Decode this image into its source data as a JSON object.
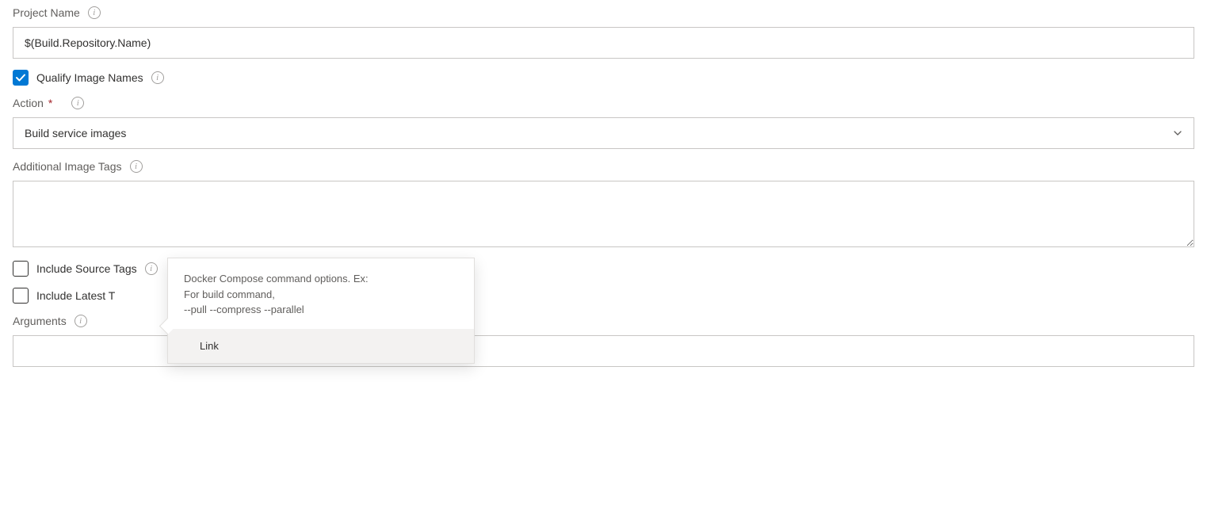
{
  "projectName": {
    "label": "Project Name",
    "value": "$(Build.Repository.Name)"
  },
  "qualifyImageNames": {
    "label": "Qualify Image Names",
    "checked": true
  },
  "action": {
    "label": "Action",
    "required": "*",
    "value": "Build service images"
  },
  "additionalImageTags": {
    "label": "Additional Image Tags",
    "value": ""
  },
  "includeSourceTags": {
    "label": "Include Source Tags",
    "checked": false
  },
  "includeLatestTag": {
    "label": "Include Latest Tag",
    "visibleLabel": "Include Latest T",
    "checked": false
  },
  "arguments": {
    "label": "Arguments",
    "value": ""
  },
  "tooltip": {
    "text": "Docker Compose command options. Ex:\nFor build command,\n--pull --compress --parallel",
    "link": "Link"
  }
}
